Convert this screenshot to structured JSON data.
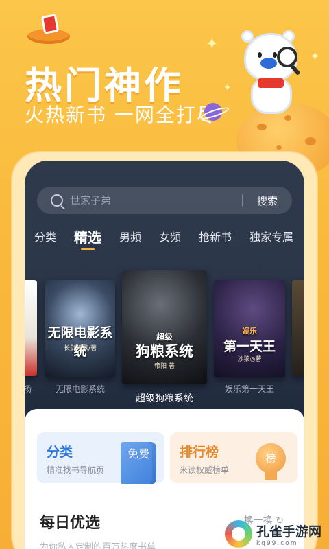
{
  "promo": {
    "headline": "热门神作",
    "subline": "火热新书 一网全打尽"
  },
  "search": {
    "placeholder": "世家子弟",
    "button_label": "搜索"
  },
  "tabs": [
    {
      "label": "分类",
      "active": false
    },
    {
      "label": "精选",
      "active": true
    },
    {
      "label": "男频",
      "active": false
    },
    {
      "label": "女频",
      "active": false
    },
    {
      "label": "抢新书",
      "active": false
    },
    {
      "label": "独家专属",
      "active": false
    }
  ],
  "covers": {
    "left": {
      "title_art": "无限电影系统",
      "author_art": "长剑鸣歌/著",
      "caption": "无限电影系统"
    },
    "center": {
      "title_art_top": "超级",
      "title_art": "狗粮系统",
      "author_art": "帝阳 著",
      "caption": "超级狗粮系统"
    },
    "right": {
      "title_art_top": "娱乐",
      "title_art": "第一天王",
      "author_art": "沙狼◎著",
      "caption": "娱乐第一天王"
    },
    "far_left_caption": "扬"
  },
  "entries": {
    "category": {
      "title": "分类",
      "subtitle": "精准找书导航页",
      "badge": "免费"
    },
    "ranking": {
      "title": "排行榜",
      "subtitle": "米读权威榜单",
      "badge": "榜"
    }
  },
  "daily": {
    "title": "每日优选",
    "refresh_label": "换一换",
    "subtitle": "为你私人定制的百万热度书单"
  },
  "watermark": {
    "name": "孔雀手游网",
    "site": "kq99.com"
  },
  "colors": {
    "background": "#f9b93c",
    "screen_dark": "#2a3447",
    "tab_indicator": "#f7b13c",
    "category_blue": "#2e78d8",
    "ranking_orange": "#e58a2b"
  }
}
